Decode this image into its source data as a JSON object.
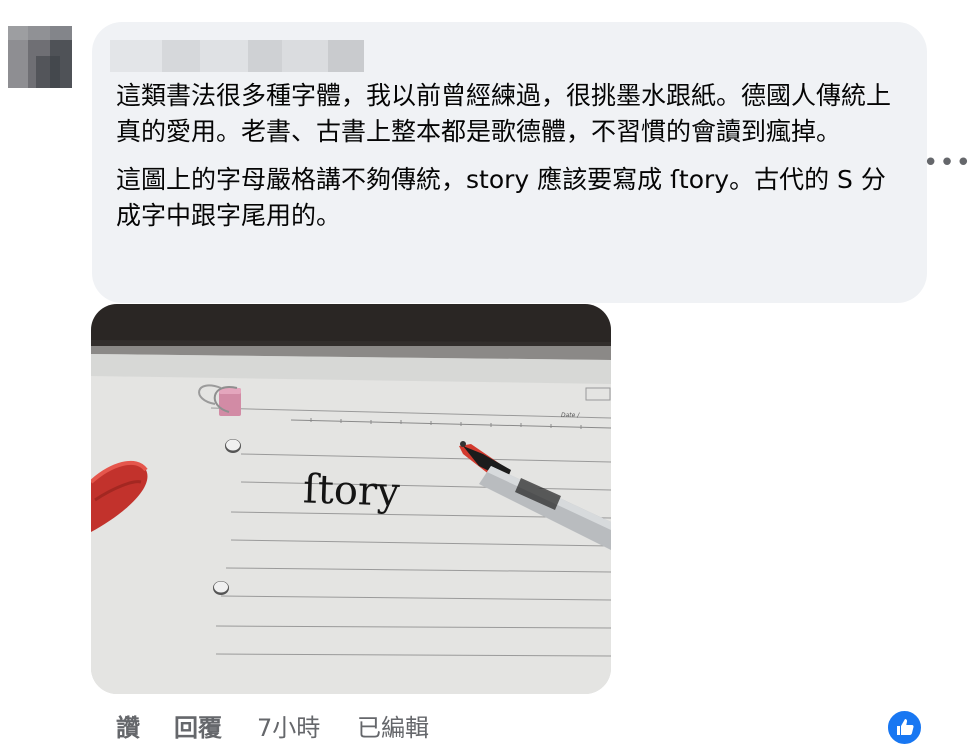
{
  "comment": {
    "author_name": "",
    "paragraphs": [
      "這類書法很多種字體，我以前曾經練過，很挑墨水跟紙。德國人傳統上真的愛用。老書、古書上整本都是歌德體，不習慣的會讀到瘋掉。",
      "這圖上的字母嚴格講不夠傳統，story 應該要寫成 ſtory。古代的 S 分成字中跟字尾用的。"
    ],
    "attached_photo": {
      "handwritten_word": "ſtory",
      "form_label": "Date /"
    }
  },
  "actions": {
    "like_label": "讚",
    "reply_label": "回覆",
    "time_label": "7小時",
    "edited_label": "已編輯"
  },
  "menu": {
    "more_glyph": "•••"
  },
  "reaction": {
    "icon": "thumbs-up-icon",
    "color": "#1877f2"
  },
  "colors": {
    "bubble": "#f0f2f5",
    "secondary_text": "#65676b",
    "primary_text": "#050505"
  }
}
